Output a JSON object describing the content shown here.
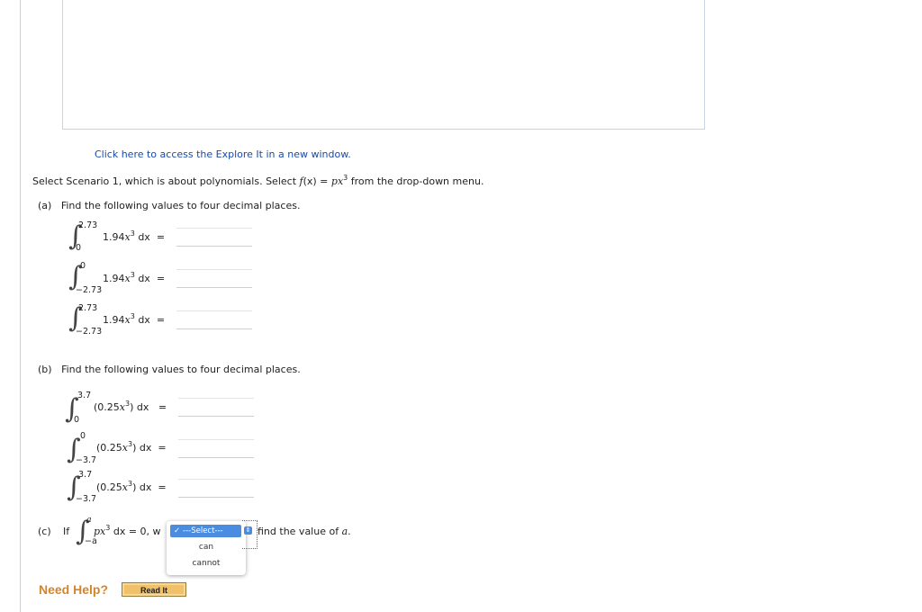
{
  "explore_link": "Click here to access the Explore It in a new window.",
  "instruction": {
    "prefix": "Select Scenario 1, which is about polynomials. Select ",
    "f": "f",
    "x": "(x)",
    "eq": " = ",
    "p": "p",
    "x2": "x",
    "exp": "3",
    "suffix": " from the drop-down menu."
  },
  "part_a": {
    "label": "(a)",
    "text": "Find the following values to four decimal places.",
    "integrals": [
      {
        "upper": "2.73",
        "lower": "0",
        "coef": "1.94",
        "var": "x",
        "exp": "3",
        "dx": "dx",
        "eq": "="
      },
      {
        "upper": "0",
        "lower": "−2.73",
        "coef": "1.94",
        "var": "x",
        "exp": "3",
        "dx": "dx",
        "eq": "="
      },
      {
        "upper": "2.73",
        "lower": "−2.73",
        "coef": "1.94",
        "var": "x",
        "exp": "3",
        "dx": "dx",
        "eq": "="
      }
    ]
  },
  "part_b": {
    "label": "(b)",
    "text": "Find the following values to four decimal places.",
    "integrals": [
      {
        "upper": "3.7",
        "lower": "0",
        "open": "(0.25",
        "var": "x",
        "exp": "3",
        "close": ")",
        "dx": "dx",
        "eq": "="
      },
      {
        "upper": "0",
        "lower": "−3.7",
        "open": "(0.25",
        "var": "x",
        "exp": "3",
        "close": ")",
        "dx": "dx",
        "eq": "="
      },
      {
        "upper": "3.7",
        "lower": "−3.7",
        "open": "(0.25",
        "var": "x",
        "exp": "3",
        "close": ")",
        "dx": "dx",
        "eq": "="
      }
    ]
  },
  "part_c": {
    "label": "(c)",
    "if": "If",
    "upper": "a",
    "lower": "−a",
    "p": "p",
    "var": "x",
    "exp": "3",
    "dx_eq": " dx = 0, w",
    "tail_prefix": "find the value of ",
    "tail_var": "a",
    "tail_period": "."
  },
  "dropdown": {
    "check": "✓",
    "selected": "---Select---",
    "options": [
      "can",
      "cannot"
    ]
  },
  "help": {
    "label": "Need Help?",
    "button": "Read It"
  }
}
